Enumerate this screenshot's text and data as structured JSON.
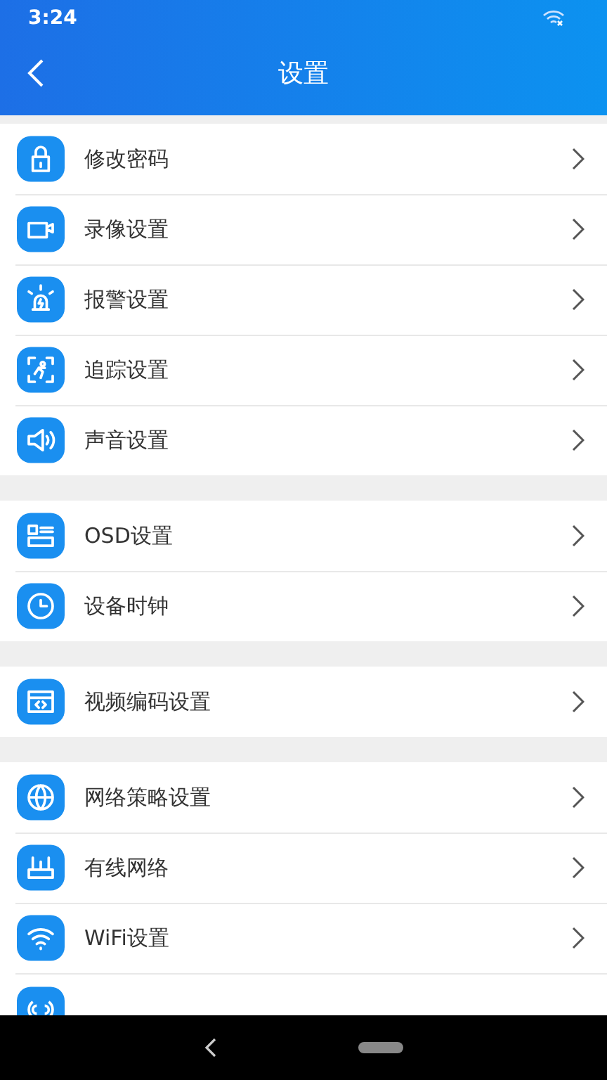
{
  "status_bar": {
    "time": "3:24"
  },
  "header": {
    "title": "设置"
  },
  "groups": [
    {
      "items": [
        {
          "label": "修改密码"
        },
        {
          "label": "录像设置"
        },
        {
          "label": "报警设置"
        },
        {
          "label": "追踪设置"
        },
        {
          "label": "声音设置"
        }
      ]
    },
    {
      "items": [
        {
          "label": "OSD设置"
        },
        {
          "label": "设备时钟"
        }
      ]
    },
    {
      "items": [
        {
          "label": "视频编码设置"
        }
      ]
    },
    {
      "items": [
        {
          "label": "网络策略设置"
        },
        {
          "label": "有线网络"
        },
        {
          "label": "WiFi设置"
        }
      ]
    }
  ]
}
